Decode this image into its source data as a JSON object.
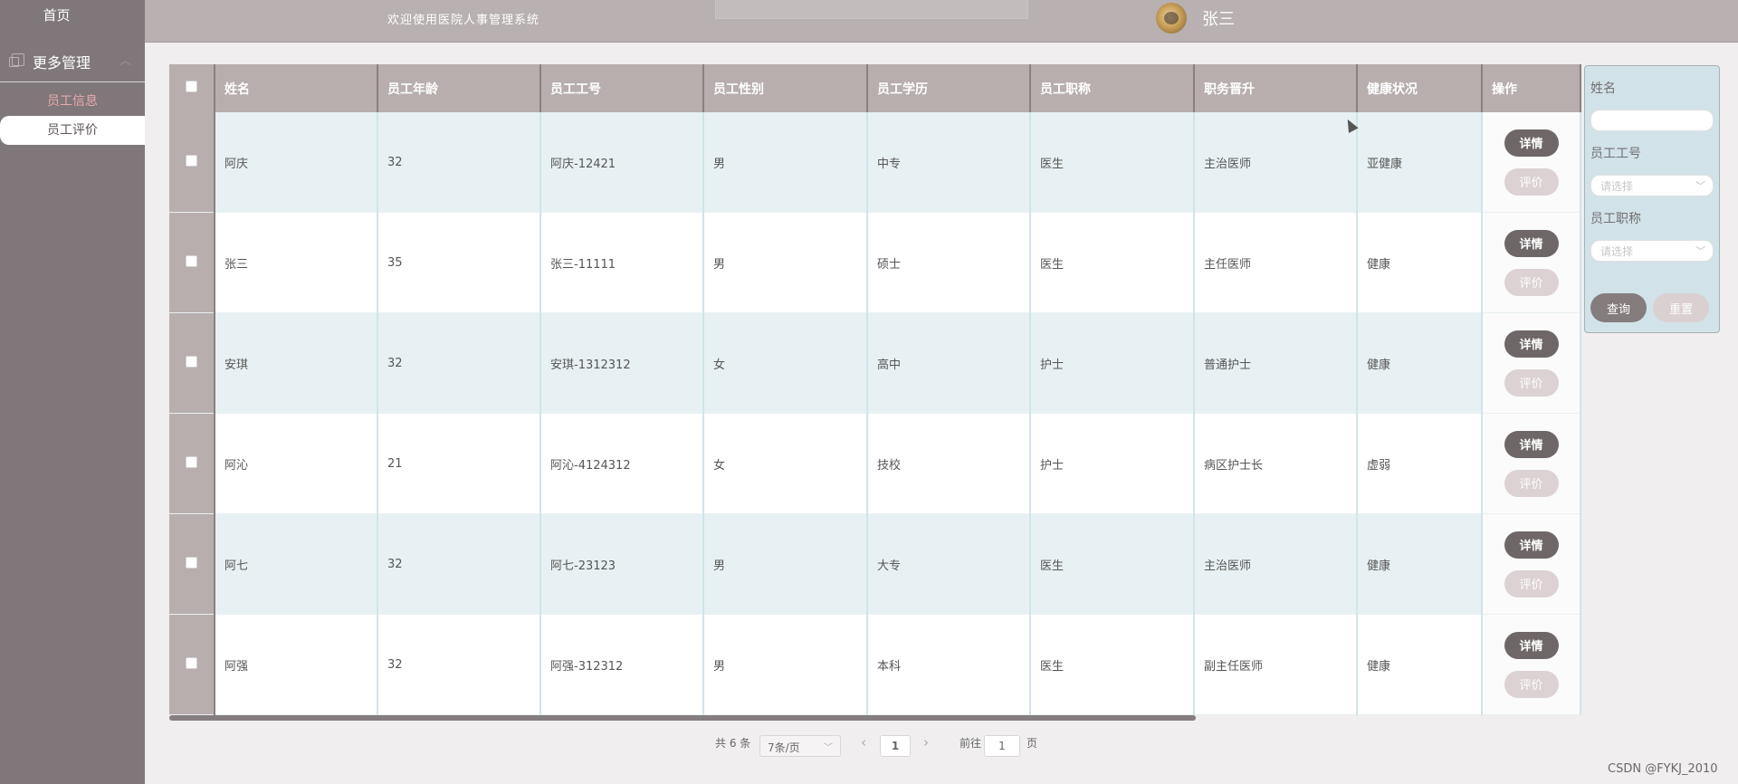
{
  "sidebar": {
    "home": "首页",
    "menu": {
      "label": "更多管理",
      "arrow": "︿"
    },
    "items": [
      {
        "label": "员工信息"
      },
      {
        "label": "员工评价"
      }
    ]
  },
  "header": {
    "title": "欢迎使用医院人事管理系统",
    "user": "张三"
  },
  "table": {
    "columns": [
      "姓名",
      "员工年龄",
      "员工工号",
      "员工性别",
      "员工学历",
      "员工职称",
      "职务晋升",
      "健康状况",
      "操作"
    ],
    "rows": [
      {
        "name": "阿庆",
        "age": "32",
        "id": "阿庆-12421",
        "gender": "男",
        "edu": "中专",
        "title": "医生",
        "promo": "主治医师",
        "health": "亚健康"
      },
      {
        "name": "张三",
        "age": "35",
        "id": "张三-11111",
        "gender": "男",
        "edu": "硕士",
        "title": "医生",
        "promo": "主任医师",
        "health": "健康"
      },
      {
        "name": "安琪",
        "age": "32",
        "id": "安琪-1312312",
        "gender": "女",
        "edu": "高中",
        "title": "护士",
        "promo": "普通护士",
        "health": "健康"
      },
      {
        "name": "阿沁",
        "age": "21",
        "id": "阿沁-4124312",
        "gender": "女",
        "edu": "技校",
        "title": "护士",
        "promo": "病区护士长",
        "health": "虚弱"
      },
      {
        "name": "阿七",
        "age": "32",
        "id": "阿七-23123",
        "gender": "男",
        "edu": "大专",
        "title": "医生",
        "promo": "主治医师",
        "health": "健康"
      },
      {
        "name": "阿强",
        "age": "32",
        "id": "阿强-312312",
        "gender": "男",
        "edu": "本科",
        "title": "医生",
        "promo": "副主任医师",
        "health": "健康"
      }
    ],
    "detail_label": "详情",
    "eval_label": "评价"
  },
  "search": {
    "name_label": "姓名",
    "name_value": "",
    "id_label": "员工工号",
    "id_placeholder": "请选择",
    "title_label": "员工职称",
    "title_placeholder": "请选择",
    "query_label": "查询",
    "reset_label": "重置"
  },
  "pagination": {
    "total": "共 6 条",
    "page_size": "7条/页",
    "prev": "‹",
    "current": "1",
    "next": "›",
    "goto_prefix": "前往",
    "goto_value": "1",
    "goto_suffix": "页"
  },
  "watermark": "CSDN @FYKJ_2010",
  "colors": {
    "sidebar": "#7f7779",
    "header": "#b8b0b1",
    "table_header": "#b8aeae",
    "row_alt": "#e7f1f3",
    "detail_button": "#6f6767",
    "eval_button": "#dcd2d3",
    "query_button": "#857c7d",
    "reset_button": "#dad0d1",
    "search_panel": "#d1e2e8"
  }
}
